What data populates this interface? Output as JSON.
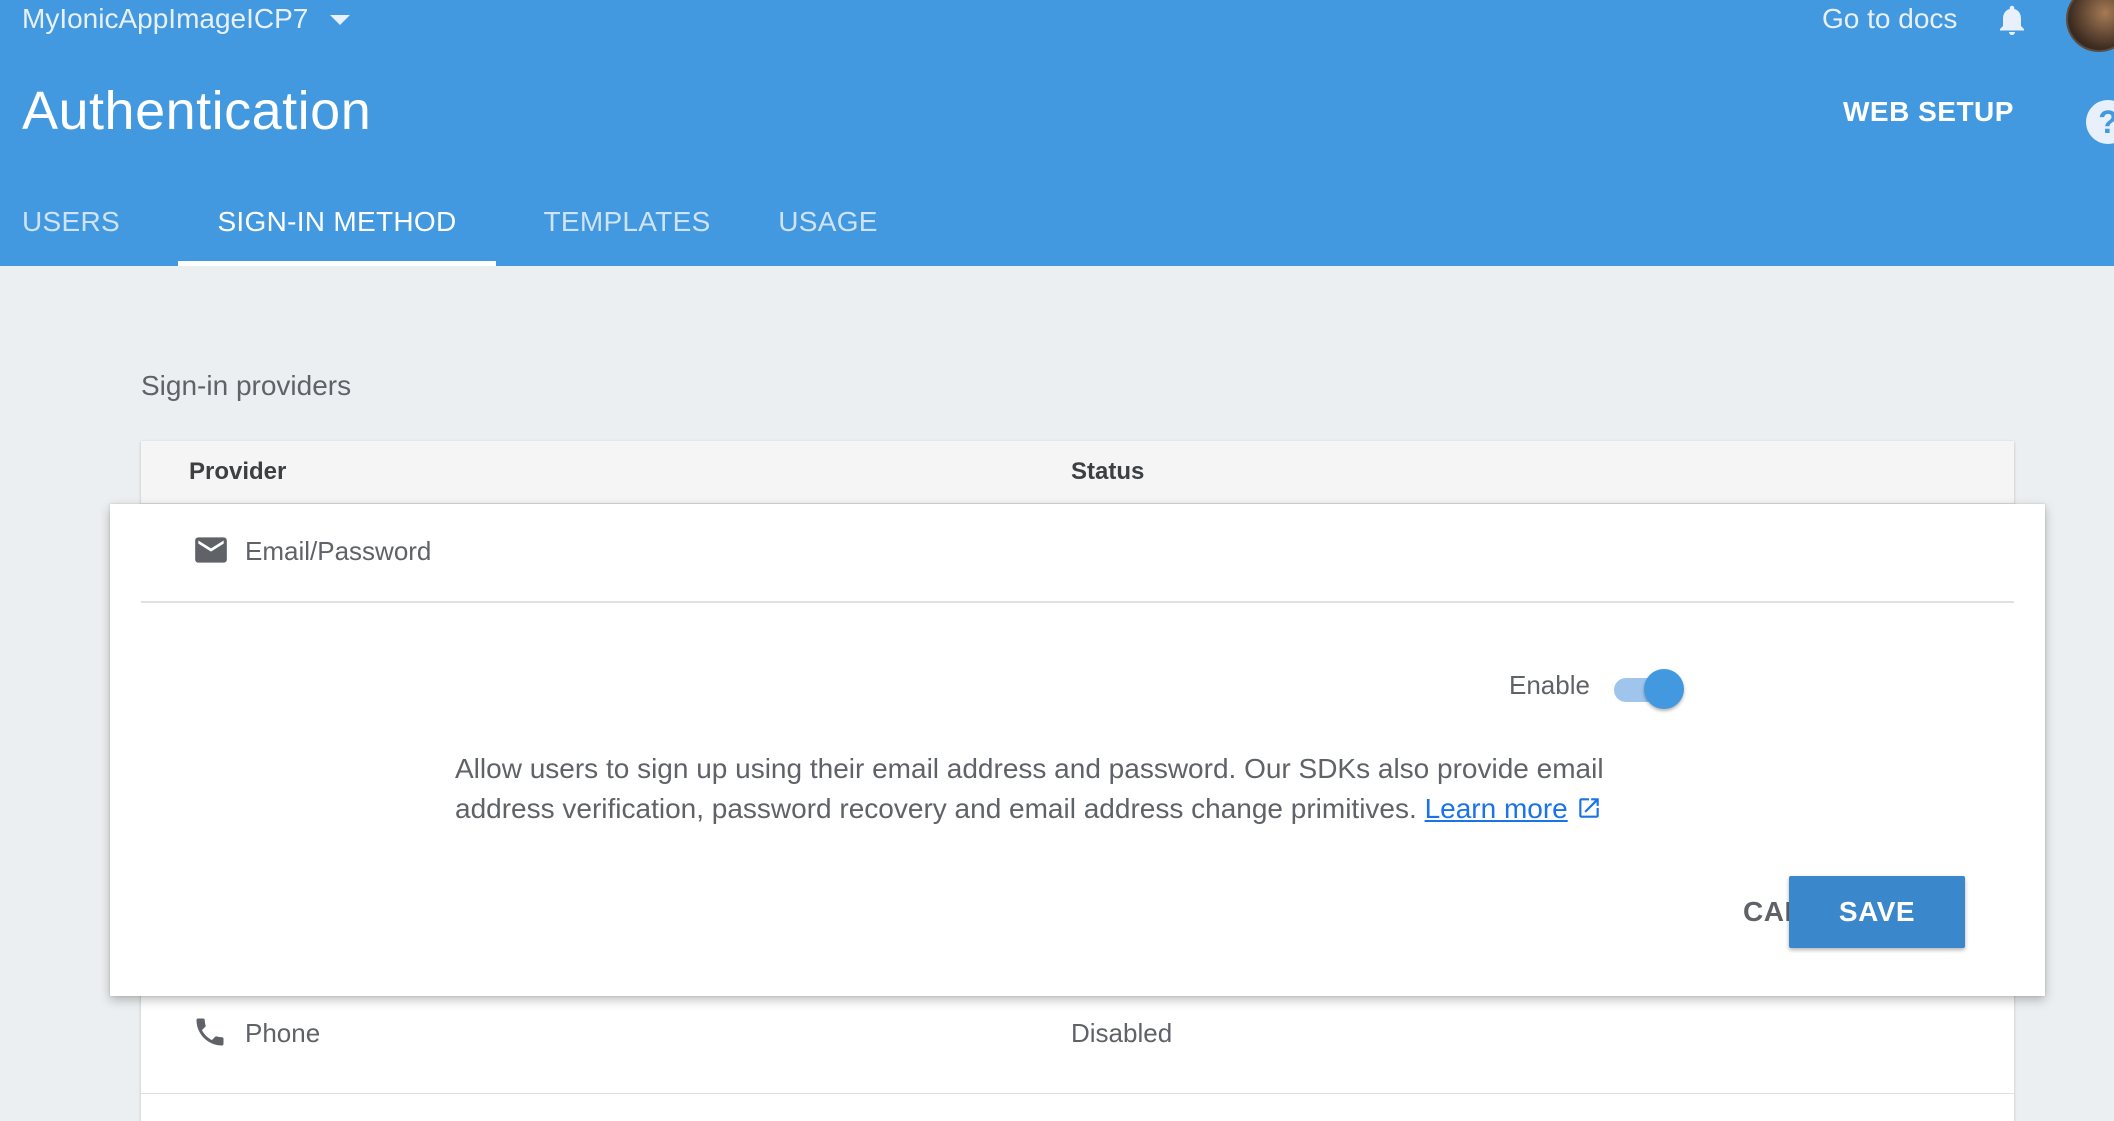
{
  "header": {
    "project_name": "MyIonicAppImageICP7",
    "docs_link": "Go to docs",
    "page_title": "Authentication",
    "web_setup": "WEB SETUP",
    "help_glyph": "?",
    "icons": [
      "chevron-down-icon",
      "notifications-bell-icon",
      "help-icon"
    ]
  },
  "tabs": [
    {
      "label": "USERS",
      "active": false
    },
    {
      "label": "SIGN-IN METHOD",
      "active": true
    },
    {
      "label": "TEMPLATES",
      "active": false
    },
    {
      "label": "USAGE",
      "active": false
    }
  ],
  "providers_section": {
    "title": "Sign-in providers",
    "columns": [
      "Provider",
      "Status"
    ],
    "expanded_provider": {
      "label": "Email/Password",
      "icon": "email-icon",
      "enable_label": "Enable",
      "enabled": true,
      "description": "Allow users to sign up using their email address and password. Our SDKs also provide email address verification, password recovery and email address change primitives.",
      "learn_more": "Learn more",
      "cancel_label": "CANCEL",
      "save_label": "SAVE"
    },
    "rows": [
      {
        "label": "Phone",
        "icon": "phone-icon",
        "status": "Disabled"
      }
    ]
  },
  "colors": {
    "header_bg": "#4399df",
    "page_bg": "#eceff1",
    "primary_button": "#3b87cb",
    "toggle_on": "#4399df",
    "link": "#1a73e8"
  }
}
